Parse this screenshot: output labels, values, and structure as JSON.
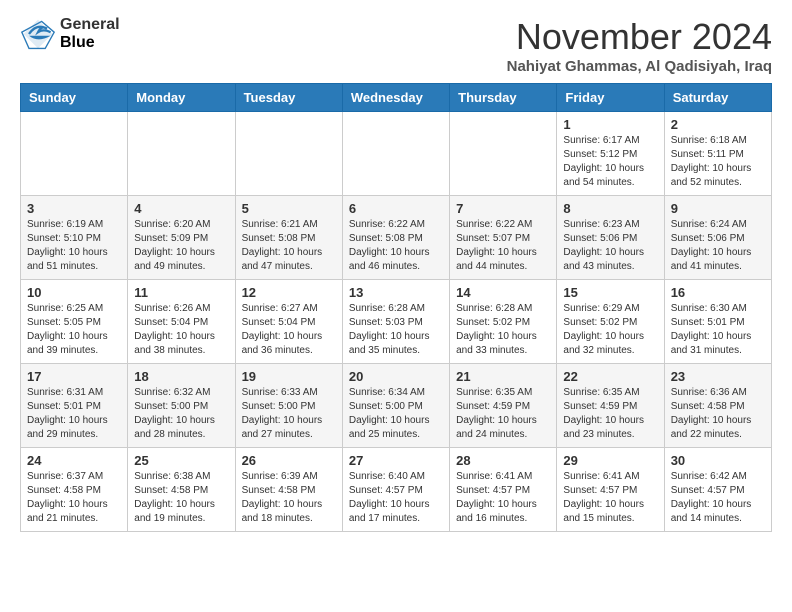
{
  "header": {
    "logo_general": "General",
    "logo_blue": "Blue",
    "month_title": "November 2024",
    "subtitle": "Nahiyat Ghammas, Al Qadisiyah, Iraq"
  },
  "weekdays": [
    "Sunday",
    "Monday",
    "Tuesday",
    "Wednesday",
    "Thursday",
    "Friday",
    "Saturday"
  ],
  "weeks": [
    [
      {
        "day": "",
        "sunrise": "",
        "sunset": "",
        "daylight": ""
      },
      {
        "day": "",
        "sunrise": "",
        "sunset": "",
        "daylight": ""
      },
      {
        "day": "",
        "sunrise": "",
        "sunset": "",
        "daylight": ""
      },
      {
        "day": "",
        "sunrise": "",
        "sunset": "",
        "daylight": ""
      },
      {
        "day": "",
        "sunrise": "",
        "sunset": "",
        "daylight": ""
      },
      {
        "day": "1",
        "sunrise": "Sunrise: 6:17 AM",
        "sunset": "Sunset: 5:12 PM",
        "daylight": "Daylight: 10 hours and 54 minutes."
      },
      {
        "day": "2",
        "sunrise": "Sunrise: 6:18 AM",
        "sunset": "Sunset: 5:11 PM",
        "daylight": "Daylight: 10 hours and 52 minutes."
      }
    ],
    [
      {
        "day": "3",
        "sunrise": "Sunrise: 6:19 AM",
        "sunset": "Sunset: 5:10 PM",
        "daylight": "Daylight: 10 hours and 51 minutes."
      },
      {
        "day": "4",
        "sunrise": "Sunrise: 6:20 AM",
        "sunset": "Sunset: 5:09 PM",
        "daylight": "Daylight: 10 hours and 49 minutes."
      },
      {
        "day": "5",
        "sunrise": "Sunrise: 6:21 AM",
        "sunset": "Sunset: 5:08 PM",
        "daylight": "Daylight: 10 hours and 47 minutes."
      },
      {
        "day": "6",
        "sunrise": "Sunrise: 6:22 AM",
        "sunset": "Sunset: 5:08 PM",
        "daylight": "Daylight: 10 hours and 46 minutes."
      },
      {
        "day": "7",
        "sunrise": "Sunrise: 6:22 AM",
        "sunset": "Sunset: 5:07 PM",
        "daylight": "Daylight: 10 hours and 44 minutes."
      },
      {
        "day": "8",
        "sunrise": "Sunrise: 6:23 AM",
        "sunset": "Sunset: 5:06 PM",
        "daylight": "Daylight: 10 hours and 43 minutes."
      },
      {
        "day": "9",
        "sunrise": "Sunrise: 6:24 AM",
        "sunset": "Sunset: 5:06 PM",
        "daylight": "Daylight: 10 hours and 41 minutes."
      }
    ],
    [
      {
        "day": "10",
        "sunrise": "Sunrise: 6:25 AM",
        "sunset": "Sunset: 5:05 PM",
        "daylight": "Daylight: 10 hours and 39 minutes."
      },
      {
        "day": "11",
        "sunrise": "Sunrise: 6:26 AM",
        "sunset": "Sunset: 5:04 PM",
        "daylight": "Daylight: 10 hours and 38 minutes."
      },
      {
        "day": "12",
        "sunrise": "Sunrise: 6:27 AM",
        "sunset": "Sunset: 5:04 PM",
        "daylight": "Daylight: 10 hours and 36 minutes."
      },
      {
        "day": "13",
        "sunrise": "Sunrise: 6:28 AM",
        "sunset": "Sunset: 5:03 PM",
        "daylight": "Daylight: 10 hours and 35 minutes."
      },
      {
        "day": "14",
        "sunrise": "Sunrise: 6:28 AM",
        "sunset": "Sunset: 5:02 PM",
        "daylight": "Daylight: 10 hours and 33 minutes."
      },
      {
        "day": "15",
        "sunrise": "Sunrise: 6:29 AM",
        "sunset": "Sunset: 5:02 PM",
        "daylight": "Daylight: 10 hours and 32 minutes."
      },
      {
        "day": "16",
        "sunrise": "Sunrise: 6:30 AM",
        "sunset": "Sunset: 5:01 PM",
        "daylight": "Daylight: 10 hours and 31 minutes."
      }
    ],
    [
      {
        "day": "17",
        "sunrise": "Sunrise: 6:31 AM",
        "sunset": "Sunset: 5:01 PM",
        "daylight": "Daylight: 10 hours and 29 minutes."
      },
      {
        "day": "18",
        "sunrise": "Sunrise: 6:32 AM",
        "sunset": "Sunset: 5:00 PM",
        "daylight": "Daylight: 10 hours and 28 minutes."
      },
      {
        "day": "19",
        "sunrise": "Sunrise: 6:33 AM",
        "sunset": "Sunset: 5:00 PM",
        "daylight": "Daylight: 10 hours and 27 minutes."
      },
      {
        "day": "20",
        "sunrise": "Sunrise: 6:34 AM",
        "sunset": "Sunset: 5:00 PM",
        "daylight": "Daylight: 10 hours and 25 minutes."
      },
      {
        "day": "21",
        "sunrise": "Sunrise: 6:35 AM",
        "sunset": "Sunset: 4:59 PM",
        "daylight": "Daylight: 10 hours and 24 minutes."
      },
      {
        "day": "22",
        "sunrise": "Sunrise: 6:35 AM",
        "sunset": "Sunset: 4:59 PM",
        "daylight": "Daylight: 10 hours and 23 minutes."
      },
      {
        "day": "23",
        "sunrise": "Sunrise: 6:36 AM",
        "sunset": "Sunset: 4:58 PM",
        "daylight": "Daylight: 10 hours and 22 minutes."
      }
    ],
    [
      {
        "day": "24",
        "sunrise": "Sunrise: 6:37 AM",
        "sunset": "Sunset: 4:58 PM",
        "daylight": "Daylight: 10 hours and 21 minutes."
      },
      {
        "day": "25",
        "sunrise": "Sunrise: 6:38 AM",
        "sunset": "Sunset: 4:58 PM",
        "daylight": "Daylight: 10 hours and 19 minutes."
      },
      {
        "day": "26",
        "sunrise": "Sunrise: 6:39 AM",
        "sunset": "Sunset: 4:58 PM",
        "daylight": "Daylight: 10 hours and 18 minutes."
      },
      {
        "day": "27",
        "sunrise": "Sunrise: 6:40 AM",
        "sunset": "Sunset: 4:57 PM",
        "daylight": "Daylight: 10 hours and 17 minutes."
      },
      {
        "day": "28",
        "sunrise": "Sunrise: 6:41 AM",
        "sunset": "Sunset: 4:57 PM",
        "daylight": "Daylight: 10 hours and 16 minutes."
      },
      {
        "day": "29",
        "sunrise": "Sunrise: 6:41 AM",
        "sunset": "Sunset: 4:57 PM",
        "daylight": "Daylight: 10 hours and 15 minutes."
      },
      {
        "day": "30",
        "sunrise": "Sunrise: 6:42 AM",
        "sunset": "Sunset: 4:57 PM",
        "daylight": "Daylight: 10 hours and 14 minutes."
      }
    ]
  ]
}
